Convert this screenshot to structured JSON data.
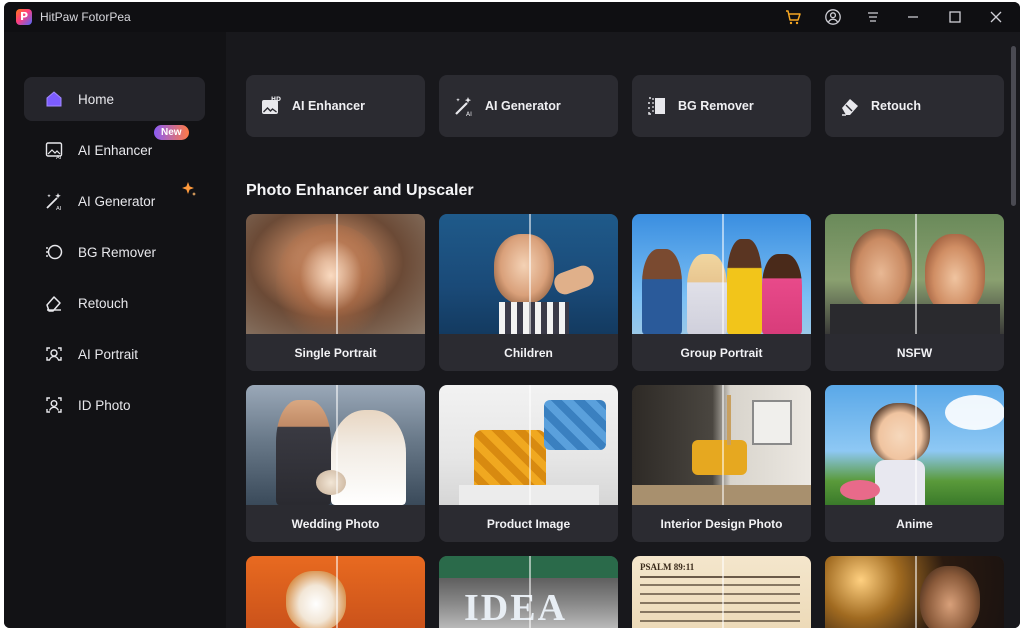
{
  "app": {
    "title": "HitPaw FotorPea"
  },
  "titlebar": {
    "icons": [
      "cart-icon",
      "account-icon",
      "menu-icon",
      "minimize-icon",
      "maximize-icon",
      "close-icon"
    ]
  },
  "sidebar": {
    "items": [
      {
        "label": "Home",
        "icon": "home-icon"
      },
      {
        "label": "AI Enhancer",
        "icon": "ai-enhancer-icon"
      },
      {
        "label": "AI Generator",
        "icon": "ai-generator-icon"
      },
      {
        "label": "BG Remover",
        "icon": "bg-remover-icon"
      },
      {
        "label": "Retouch",
        "icon": "retouch-icon"
      },
      {
        "label": "AI Portrait",
        "icon": "ai-portrait-icon"
      },
      {
        "label": "ID Photo",
        "icon": "id-photo-icon"
      }
    ],
    "new_badge": "New"
  },
  "tools": [
    {
      "label": "AI Enhancer",
      "icon": "hd-image-icon"
    },
    {
      "label": "AI Generator",
      "icon": "magic-wand-icon"
    },
    {
      "label": "BG Remover",
      "icon": "bg-remover-icon"
    },
    {
      "label": "Retouch",
      "icon": "eraser-icon"
    }
  ],
  "section": {
    "title": "Photo Enhancer and Upscaler"
  },
  "cards": [
    {
      "label": "Single Portrait"
    },
    {
      "label": "Children"
    },
    {
      "label": "Group Portrait"
    },
    {
      "label": "NSFW"
    },
    {
      "label": "Wedding Photo"
    },
    {
      "label": "Product Image"
    },
    {
      "label": "Interior Design Photo"
    },
    {
      "label": "Anime"
    }
  ],
  "partial_cards": [
    {
      "caption_text": ""
    },
    {
      "caption_text": "IDEA"
    },
    {
      "caption_text": "PSALM 89:11"
    },
    {
      "caption_text": ""
    }
  ],
  "colors": {
    "background": "#121215",
    "main_bg": "#18181c",
    "card_bg": "#2b2b31",
    "accent": "#8b5cf6",
    "cart": "#f5a623"
  }
}
